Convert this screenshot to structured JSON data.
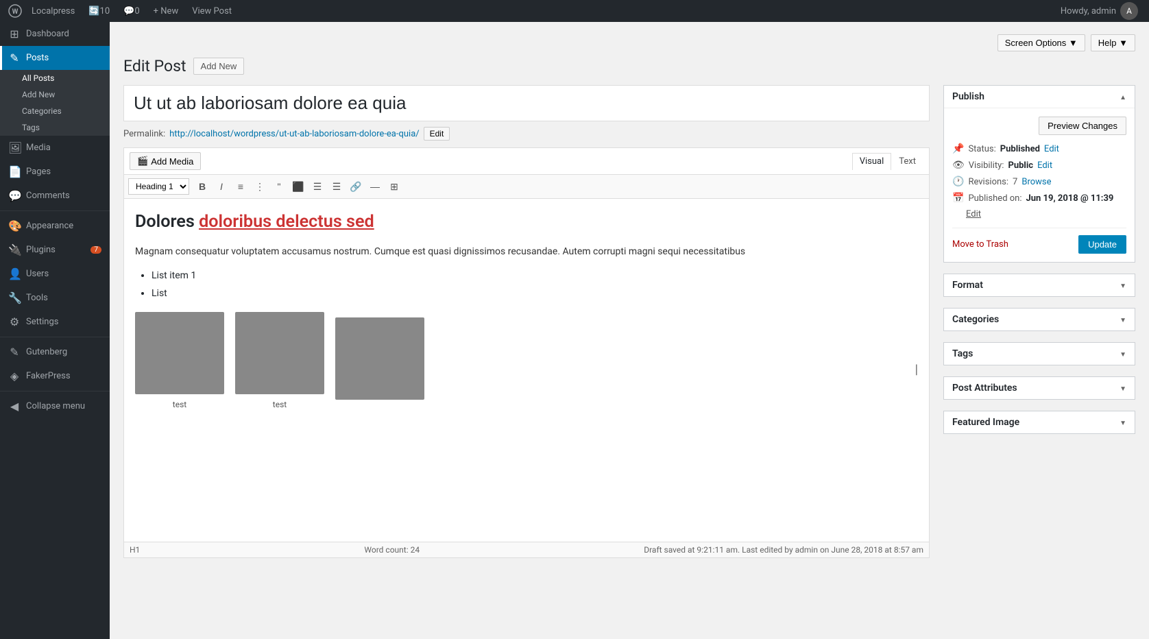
{
  "adminbar": {
    "site_name": "Localpress",
    "update_count": "10",
    "comment_count": "0",
    "new_label": "+ New",
    "view_post_label": "View Post",
    "howdy_label": "Howdy, admin"
  },
  "screen_options": {
    "label": "Screen Options ▼",
    "help_label": "Help ▼"
  },
  "page_header": {
    "title": "Edit Post",
    "add_new_label": "Add New"
  },
  "post": {
    "title": "Ut ut ab laboriosam dolore ea quia",
    "permalink_label": "Permalink:",
    "permalink_url": "http://localhost/wordpress/ut-ut-ab-laboriosam-dolore-ea-quia/",
    "permalink_edit_label": "Edit"
  },
  "editor": {
    "add_media_label": "Add Media",
    "visual_tab": "Visual",
    "text_tab": "Text",
    "heading_select": "Heading 1",
    "content_h1_plain": "Dolores ",
    "content_h1_linked": "doloribus delectus sed",
    "content_p": "Magnam consequatur voluptatem accusamus nostrum. Cumque est quasi dignissimos recusandae. Autem corrupti magni sequi necessitatibus",
    "list_item1": "List item 1",
    "list_item2": "List",
    "image1_caption": "test",
    "image2_caption": "test",
    "status_h1": "H1",
    "word_count_label": "Word count:",
    "word_count": "24",
    "draft_saved": "Draft saved at 9:21:11 am. Last edited by admin on June 28, 2018 at 8:57 am"
  },
  "sidebar": {
    "menu_items": [
      {
        "id": "dashboard",
        "label": "Dashboard",
        "icon": "⊞"
      },
      {
        "id": "posts",
        "label": "Posts",
        "icon": "📝",
        "active": true
      },
      {
        "id": "all-posts",
        "label": "All Posts",
        "icon": "",
        "sub": true,
        "active_sub": true
      },
      {
        "id": "add-new",
        "label": "Add New",
        "icon": "",
        "sub": true
      },
      {
        "id": "categories",
        "label": "Categories",
        "icon": "",
        "sub": true
      },
      {
        "id": "tags",
        "label": "Tags",
        "icon": "",
        "sub": true
      },
      {
        "id": "media",
        "label": "Media",
        "icon": "🖼"
      },
      {
        "id": "pages",
        "label": "Pages",
        "icon": "📄"
      },
      {
        "id": "comments",
        "label": "Comments",
        "icon": "💬"
      },
      {
        "id": "appearance",
        "label": "Appearance",
        "icon": "🎨"
      },
      {
        "id": "plugins",
        "label": "Plugins",
        "icon": "🔌",
        "badge": "7"
      },
      {
        "id": "users",
        "label": "Users",
        "icon": "👤"
      },
      {
        "id": "tools",
        "label": "Tools",
        "icon": "🔧"
      },
      {
        "id": "settings",
        "label": "Settings",
        "icon": "⚙"
      },
      {
        "id": "gutenberg",
        "label": "Gutenberg",
        "icon": "✎"
      },
      {
        "id": "fakerpress",
        "label": "FakerPress",
        "icon": "◈"
      },
      {
        "id": "collapse",
        "label": "Collapse menu",
        "icon": "◀"
      }
    ]
  },
  "publish_box": {
    "title": "Publish",
    "preview_btn": "Preview Changes",
    "status_label": "Status:",
    "status_value": "Published",
    "status_edit": "Edit",
    "visibility_label": "Visibility:",
    "visibility_value": "Public",
    "visibility_edit": "Edit",
    "revisions_label": "Revisions:",
    "revisions_count": "7",
    "revisions_browse": "Browse",
    "published_label": "Published on:",
    "published_value": "Jun 19, 2018 @ 11:39",
    "published_edit": "Edit",
    "trash_label": "Move to Trash",
    "update_btn": "Update"
  },
  "format_box": {
    "title": "Format"
  },
  "categories_box": {
    "title": "Categories"
  },
  "tags_box": {
    "title": "Tags"
  },
  "post_attributes_box": {
    "title": "Post Attributes"
  },
  "featured_image_box": {
    "title": "Featured Image"
  }
}
